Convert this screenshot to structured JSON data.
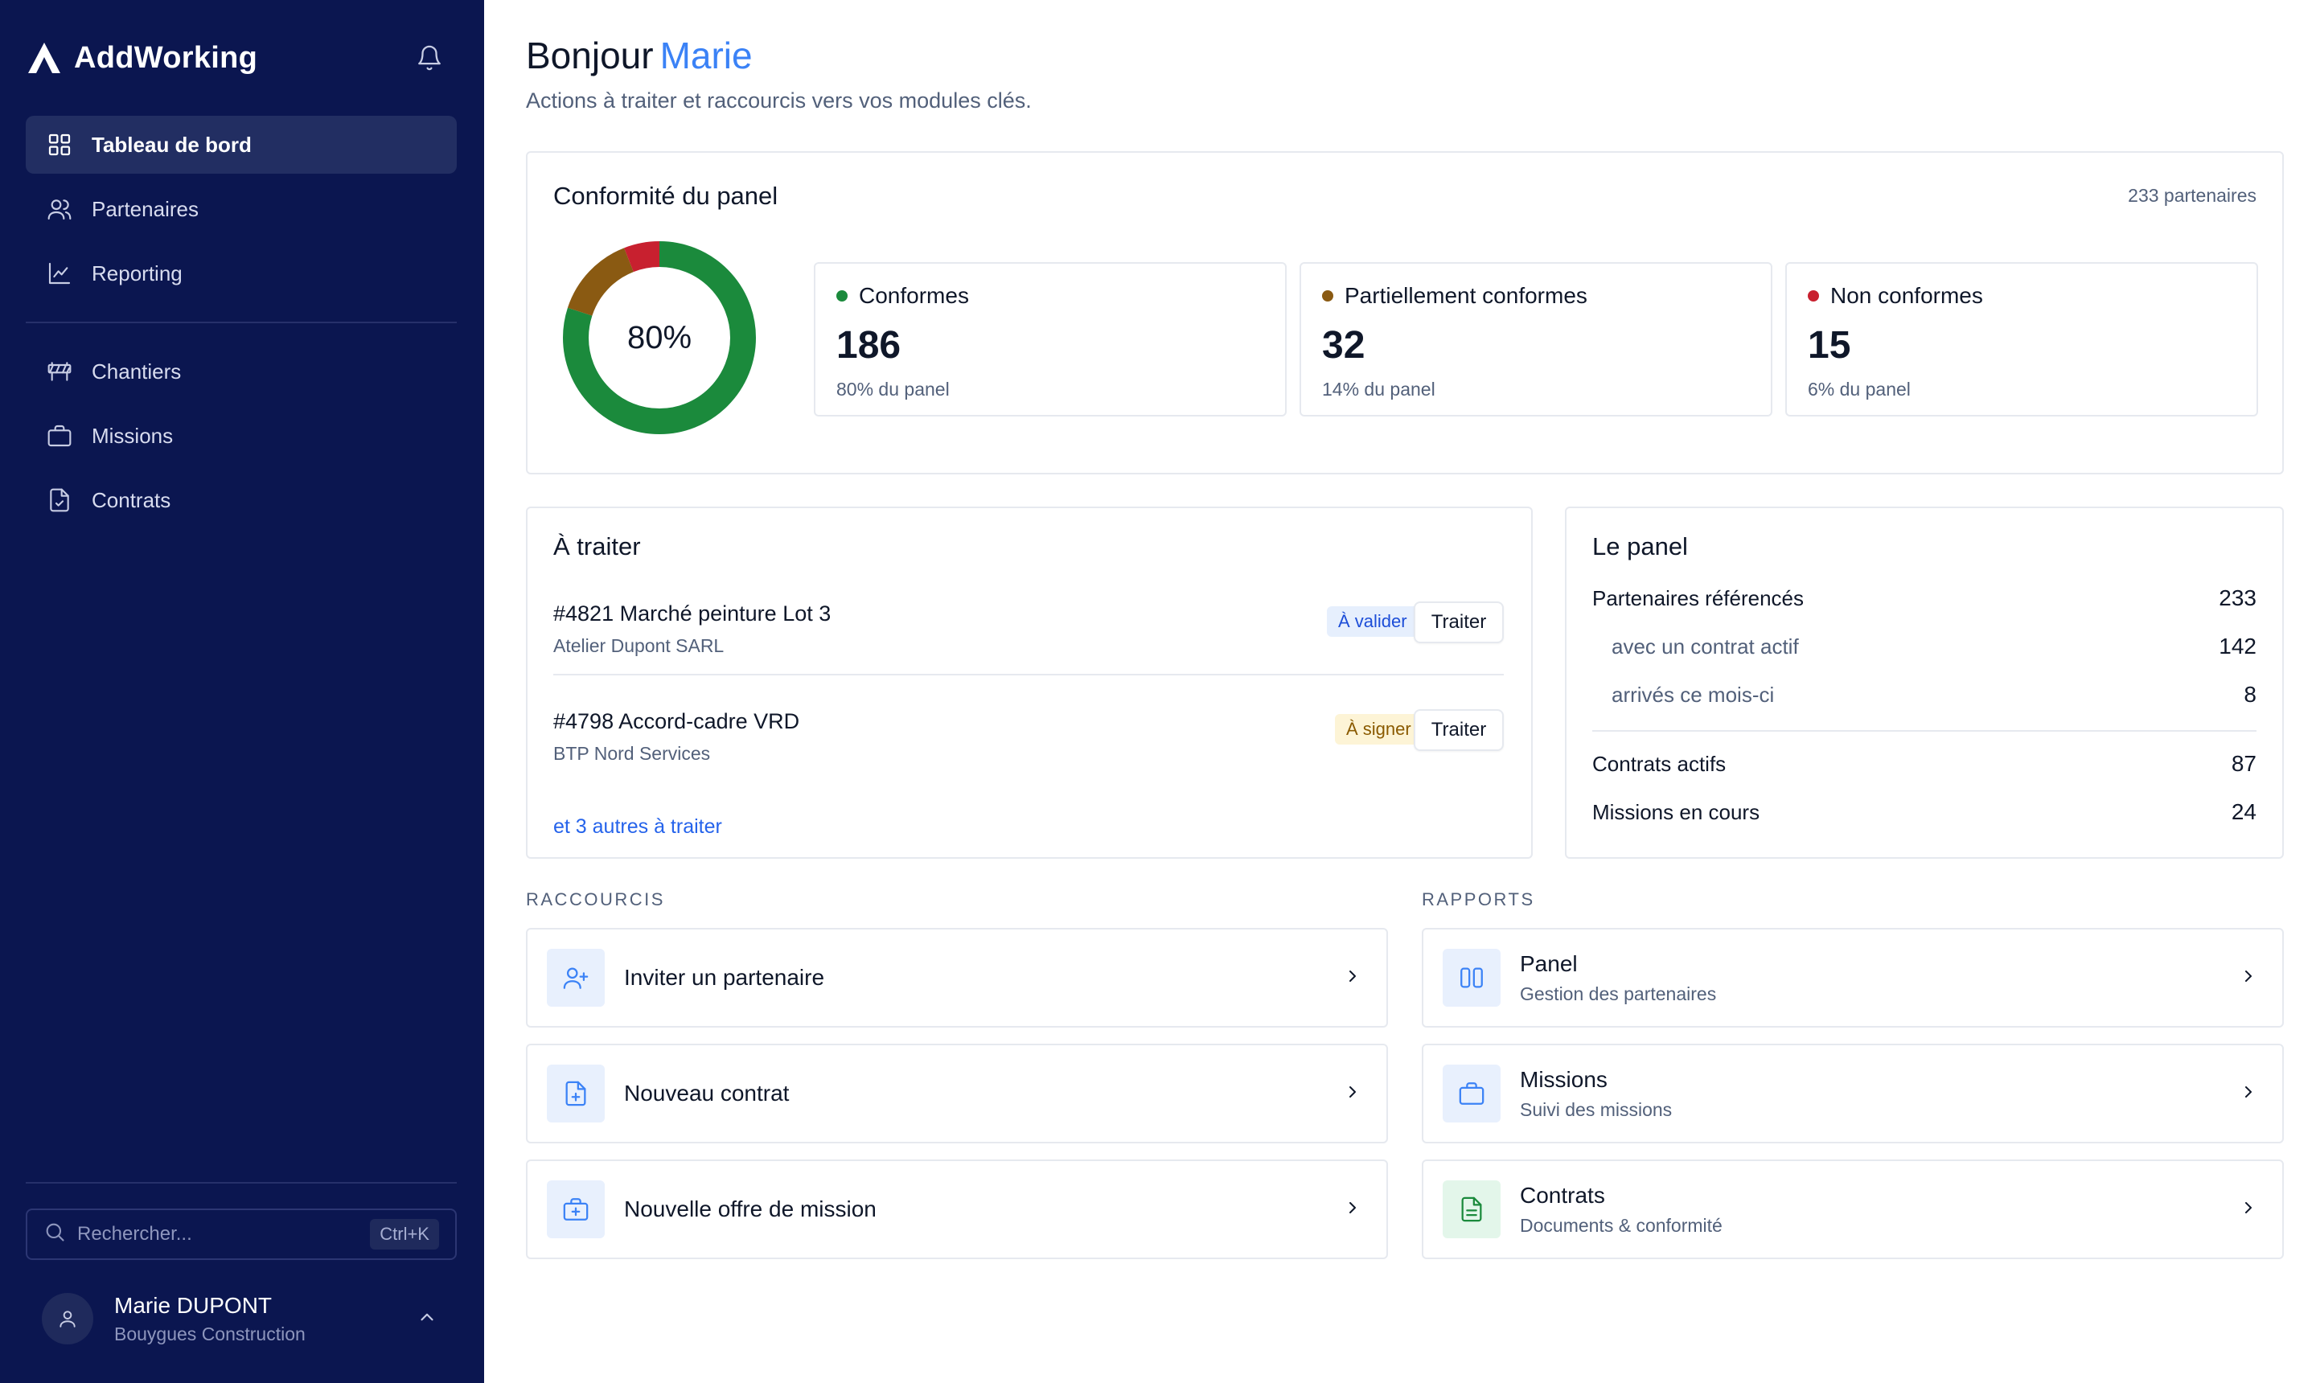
{
  "app": {
    "brand": "AddWorking",
    "notifications_icon": "bell-icon"
  },
  "sidebar": {
    "primary_items": [
      {
        "label": "Tableau de bord",
        "icon": "grid-icon",
        "active": true
      },
      {
        "label": "Partenaires",
        "icon": "users-icon",
        "active": false
      },
      {
        "label": "Reporting",
        "icon": "line-chart-icon",
        "active": false
      }
    ],
    "secondary_items": [
      {
        "label": "Chantiers",
        "icon": "road-barrier-icon"
      },
      {
        "label": "Missions",
        "icon": "briefcase-icon"
      },
      {
        "label": "Contrats",
        "icon": "file-check-icon"
      }
    ],
    "search": {
      "placeholder": "Rechercher...",
      "shortcut": "Ctrl+K"
    },
    "user": {
      "name": "Marie DUPONT",
      "company": "Bouygues Construction"
    }
  },
  "header": {
    "greeting": "Bonjour",
    "first_name": "Marie",
    "subtitle": "Actions à traiter et raccourcis vers vos modules clés."
  },
  "compliance": {
    "title": "Conformité du panel",
    "total_label": "233 partenaires",
    "donut_label": "80%",
    "donut_fractions": [
      0.8,
      0.14,
      0.06
    ],
    "colors": {
      "conformes": "#1b8a3c",
      "partiels": "#8a5a12",
      "non": "#c8202f",
      "track": "#e6e9ef"
    },
    "stats": [
      {
        "label": "Conformes",
        "value": "186",
        "pct": "80% du panel",
        "color": "#1b8a3c"
      },
      {
        "label": "Partiellement conformes",
        "value": "32",
        "pct": "14% du panel",
        "color": "#8a5a12"
      },
      {
        "label": "Non conformes",
        "value": "15",
        "pct": "6% du panel",
        "color": "#c8202f"
      }
    ]
  },
  "todo": {
    "title": "À traiter",
    "items": [
      {
        "title": "#4821 Marché peinture Lot 3",
        "company": "Atelier Dupont SARL",
        "badge": "À valider",
        "action": "Traiter"
      },
      {
        "title": "#4798 Accord-cadre VRD",
        "company": "BTP Nord Services",
        "badge": "À signer",
        "action": "Traiter"
      }
    ],
    "more_link": "et 3 autres à traiter"
  },
  "panel": {
    "title": "Le panel",
    "rows": [
      {
        "label": "Partenaires référencés",
        "value": "233"
      },
      {
        "label": "avec un contrat actif",
        "value": "142"
      },
      {
        "label": "arrivés ce mois-ci",
        "value": "8"
      },
      {
        "label": "Contrats actifs",
        "value": "87"
      },
      {
        "label": "Missions en cours",
        "value": "24"
      }
    ]
  },
  "shortcuts": {
    "label": "RACCOURCIS",
    "items": [
      {
        "label": "Inviter un partenaire",
        "icon": "user-plus-icon"
      },
      {
        "label": "Nouveau contrat",
        "icon": "file-plus-icon"
      },
      {
        "label": "Nouvelle offre de mission",
        "icon": "briefcase-plus-icon"
      }
    ]
  },
  "reports": {
    "label": "RAPPORTS",
    "items": [
      {
        "title": "Panel",
        "subtitle": "Gestion des partenaires",
        "icon": "columns-icon"
      },
      {
        "title": "Missions",
        "subtitle": "Suivi des missions",
        "icon": "briefcase-icon"
      },
      {
        "title": "Contrats",
        "subtitle": "Documents & conformité",
        "icon": "file-text-icon"
      }
    ]
  }
}
